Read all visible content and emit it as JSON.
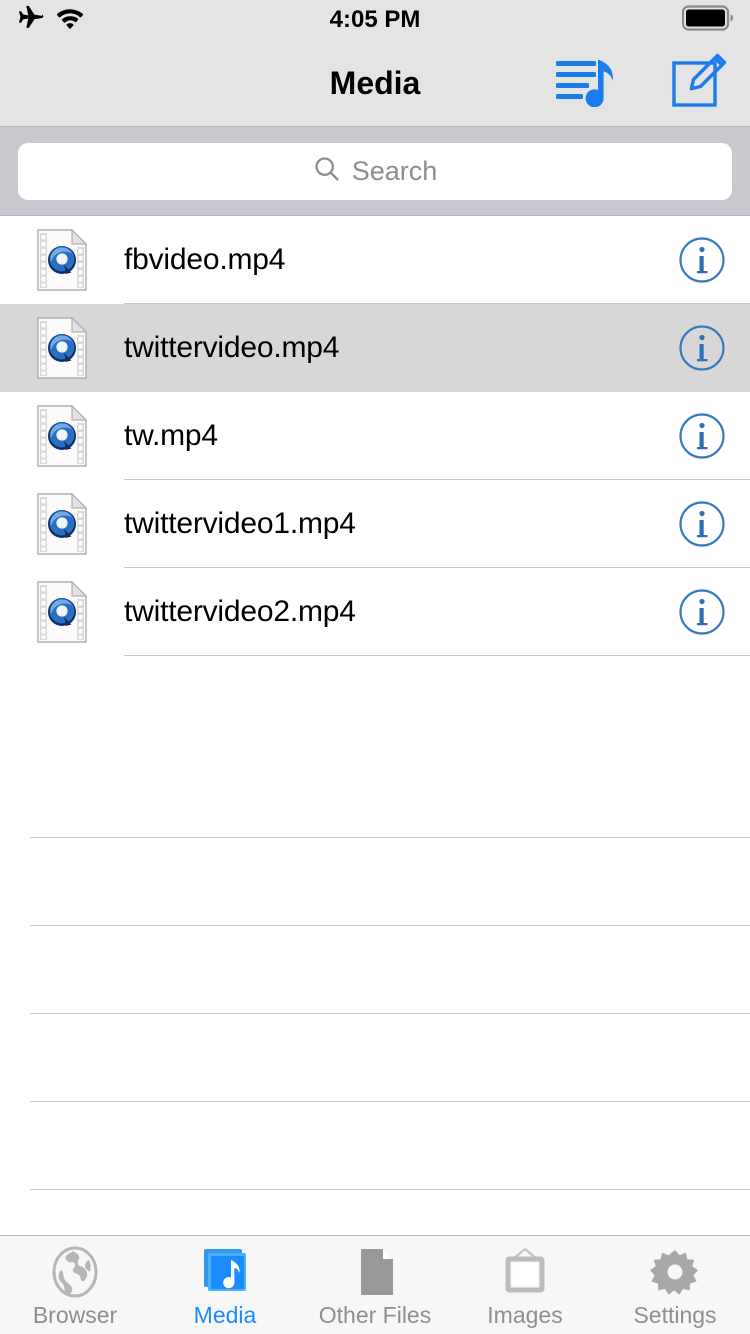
{
  "status_bar": {
    "airplane_icon": "airplane-mode-icon",
    "wifi_icon": "wifi-icon",
    "time": "4:05 PM",
    "battery_icon": "battery-icon",
    "battery_level_pct": 92
  },
  "nav_bar": {
    "title": "Media",
    "actions": [
      {
        "name": "playlist-music-icon",
        "label": "Playlist"
      },
      {
        "name": "compose-icon",
        "label": "Compose"
      }
    ],
    "tint_color": "#1a7ced"
  },
  "search": {
    "placeholder": "Search",
    "value": "",
    "icon": "search-icon"
  },
  "list": {
    "items": [
      {
        "name": "fbvideo.mp4",
        "icon": "quicktime-video-file-icon",
        "info_icon": "info-icon",
        "selected": false
      },
      {
        "name": "twittervideo.mp4",
        "icon": "quicktime-video-file-icon",
        "info_icon": "info-icon",
        "selected": true
      },
      {
        "name": "tw.mp4",
        "icon": "quicktime-video-file-icon",
        "info_icon": "info-icon",
        "selected": false
      },
      {
        "name": "twittervideo1.mp4",
        "icon": "quicktime-video-file-icon",
        "info_icon": "info-icon",
        "selected": false
      },
      {
        "name": "twittervideo2.mp4",
        "icon": "quicktime-video-file-icon",
        "info_icon": "info-icon",
        "selected": false
      }
    ],
    "empty_row_count": 6,
    "separator_color": "#c8c7cc",
    "selected_row_color": "#d7d7d7"
  },
  "tab_bar": {
    "active_index": 1,
    "active_color": "#1a8cff",
    "inactive_color": "#8e8e93",
    "tabs": [
      {
        "label": "Browser",
        "icon": "globe-icon"
      },
      {
        "label": "Media",
        "icon": "media-album-music-icon"
      },
      {
        "label": "Other Files",
        "icon": "document-icon"
      },
      {
        "label": "Images",
        "icon": "picture-frame-icon"
      },
      {
        "label": "Settings",
        "icon": "gear-icon"
      }
    ]
  }
}
